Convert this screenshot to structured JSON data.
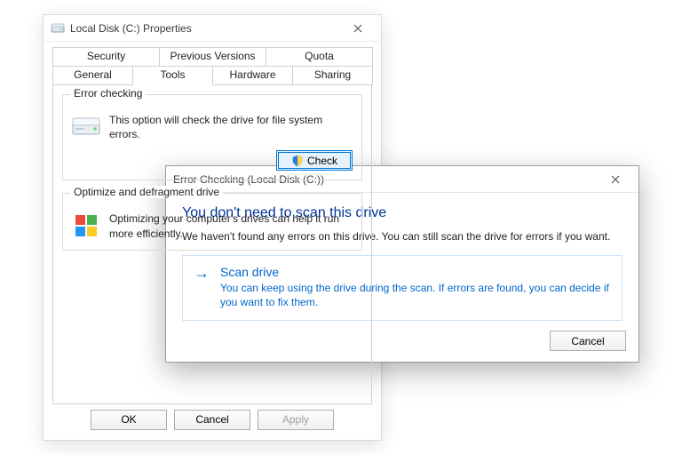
{
  "props": {
    "title": "Local Disk (C:) Properties",
    "tabs_row1": [
      "Security",
      "Previous Versions",
      "Quota"
    ],
    "tabs_row2": [
      "General",
      "Tools",
      "Hardware",
      "Sharing"
    ],
    "active_tab": "Tools",
    "groups": {
      "error_checking": {
        "legend": "Error checking",
        "text": "This option will check the drive for file system errors.",
        "button": "Check"
      },
      "optimize": {
        "legend": "Optimize and defragment drive",
        "text": "Optimizing your computer's drives can help it run more efficiently."
      }
    },
    "footer": {
      "ok": "OK",
      "cancel": "Cancel",
      "apply": "Apply"
    }
  },
  "dlg": {
    "title": "Error Checking (Local Disk (C:))",
    "headline": "You don't need to scan this drive",
    "subtext": "We haven't found any errors on this drive. You can still scan the drive for errors if you want.",
    "command": {
      "title": "Scan drive",
      "desc": "You can keep using the drive during the scan. If errors are found, you can decide if you want to fix them."
    },
    "cancel": "Cancel"
  },
  "icons": {
    "drive": "drive-icon",
    "defrag": "defrag-icon",
    "shield": "shield-icon",
    "close": "close-icon",
    "arrow": "arrow-right-icon"
  }
}
